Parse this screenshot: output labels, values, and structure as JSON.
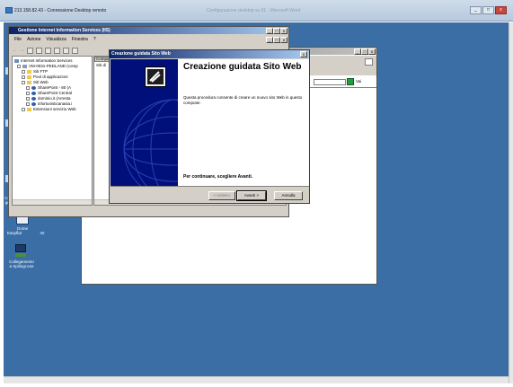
{
  "rdp": {
    "title": "213.158.82.43 - Connessione Desktop remoto",
    "dim_title": "Configurazione desktop su 01 - Microsoft Word",
    "controls": [
      "_",
      "□",
      "x"
    ]
  },
  "desktop_icons": [
    {
      "label": "Com",
      "label2": "gest"
    },
    {
      "label": "Dome",
      "label2": "Easyflat"
    },
    {
      "label": "Int",
      "label2": ""
    },
    {
      "label": "Collegamento",
      "label2": "a Xpilingr.exe"
    }
  ],
  "iis": {
    "title": "Gestione Internet Information Services (IIS)",
    "menu": [
      "File",
      "Azione",
      "Visualizza",
      "Finestra",
      "?"
    ],
    "tree": [
      {
        "label": "Internet Information Services",
        "level": 0,
        "icon": "iis-icon"
      },
      {
        "label": "VM-0031-PEDLAND (comp",
        "level": 1,
        "icon": "computer-icon"
      },
      {
        "label": "Siti FTP",
        "level": 2,
        "icon": "folder-icon"
      },
      {
        "label": "Pool di applicazioni",
        "level": 2,
        "icon": "folder-icon"
      },
      {
        "label": "Siti Web",
        "level": 2,
        "icon": "folder-icon"
      },
      {
        "label": "SharePoint - 80 (A",
        "level": 3,
        "icon": "globe-icon"
      },
      {
        "label": "SharePoint Central",
        "level": 3,
        "icon": "globe-icon"
      },
      {
        "label": "dominio.it (Arresta",
        "level": 3,
        "icon": "globe-icon"
      },
      {
        "label": "infortunisticanasia.i",
        "level": 3,
        "icon": "globe-icon"
      },
      {
        "label": "Estensioni servizio Web",
        "level": 2,
        "icon": "folder-icon"
      }
    ],
    "column_header": "Computer",
    "column_sub": "Siti di"
  },
  "win2": {
    "go_label": "Vai"
  },
  "wizard": {
    "title": "Creazione guidata Sito Web",
    "heading": "Creazione guidata Sito Web",
    "description": "Questa procedura consente di creare un nuovo sito Web in questo computer.",
    "continue_text": "Per continuare, scegliere Avanti.",
    "back_label": "< Indietro",
    "next_label": "Avanti >",
    "cancel_label": "Annulla"
  },
  "colors": {
    "desktop": "#3a6ea5",
    "wizard_side": "#000f7a",
    "title_active": "#0a246a"
  }
}
